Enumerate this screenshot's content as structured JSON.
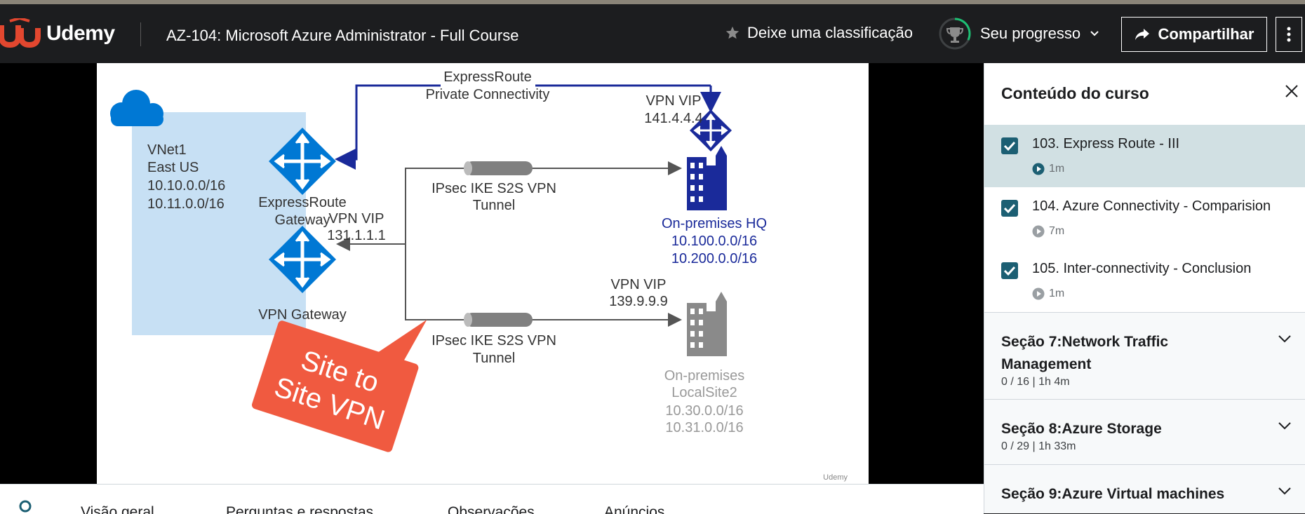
{
  "header": {
    "logo_text": "Udemy",
    "course_title": "AZ-104: Microsoft Azure Administrator - Full Course",
    "rate_label": "Deixe uma classificação",
    "progress_label": "Seu progresso",
    "share_label": "Compartilhar"
  },
  "slide": {
    "expressroute_label_1": "ExpressRoute",
    "expressroute_label_2": "Private Connectivity",
    "vnet_name": "VNet1",
    "vnet_region": "East US",
    "vnet_cidr_1": "10.10.0.0/16",
    "vnet_cidr_2": "10.11.0.0/16",
    "er_gateway_1": "ExpressRoute",
    "er_gateway_2": "Gateway",
    "vpn_gateway": "VPN Gateway",
    "vip_hq_label": "VPN VIP",
    "vip_hq_value": "141.4.4.4",
    "vip_gw_label": "VPN VIP",
    "vip_gw_value": "131.1.1.1",
    "vip_site2_label": "VPN VIP",
    "vip_site2_value": "139.9.9.9",
    "tunnel1_1": "IPsec IKE S2S VPN",
    "tunnel1_2": "Tunnel",
    "tunnel2_1": "IPsec IKE S2S VPN",
    "tunnel2_2": "Tunnel",
    "hq_name": "On-premises HQ",
    "hq_cidr_1": "10.100.0.0/16",
    "hq_cidr_2": "10.200.0.0/16",
    "site2_name_1": "On-premises",
    "site2_name_2": "LocalSite2",
    "site2_cidr_1": "10.30.0.0/16",
    "site2_cidr_2": "10.31.0.0/16",
    "callout_1": "Site to",
    "callout_2": "Site VPN",
    "watermark": "Udemy",
    "colors": {
      "azure_blue": "#0078d4",
      "dark_blue": "#1a2a9a",
      "callout_red": "#f05a40",
      "vnet_fill": "#c7e0f4"
    }
  },
  "tabs": [
    "Visão geral",
    "Perguntas e respostas",
    "Observações",
    "Anúncios"
  ],
  "sidebar": {
    "title": "Conteúdo do curso",
    "lectures": [
      {
        "title": "103. Express Route - III",
        "duration": "1m",
        "completed": true
      },
      {
        "title": "104. Azure Connectivity - Comparision",
        "duration": "7m",
        "completed": true
      },
      {
        "title": "105. Inter-connectivity - Conclusion",
        "duration": "1m",
        "completed": true
      }
    ],
    "sections": [
      {
        "title": "Seção 7:Network Traffic Management",
        "meta": "0 / 16 | 1h 4m"
      },
      {
        "title": "Seção 8:Azure Storage",
        "meta": "0 / 29 | 1h 33m"
      },
      {
        "title": "Seção 9:Azure Virtual machines",
        "meta": ""
      }
    ]
  }
}
